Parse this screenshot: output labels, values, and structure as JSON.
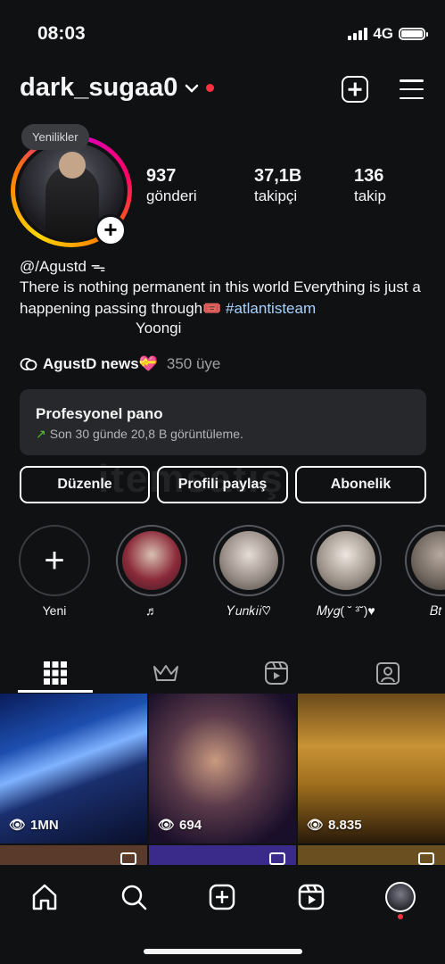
{
  "status_bar": {
    "time": "08:03",
    "network": "4G"
  },
  "header": {
    "username": "dark_sugaa0"
  },
  "profile": {
    "notes_bubble": "Yenilikler",
    "stats": [
      {
        "value": "937",
        "label": "gönderi"
      },
      {
        "value": "37,1B",
        "label": "takipçi"
      },
      {
        "value": "136",
        "label": "takip"
      }
    ],
    "handle": "@/Agustd ᯓ",
    "bio_text": "There is nothing permanent in this world Everything is just a happening passing through🎟️",
    "bio_hashtag": "#atlantisteam",
    "bio_name": "Yoongi",
    "channel": {
      "name": "AgustD news💝",
      "members": "350 üye"
    }
  },
  "dashboard": {
    "title": "Profesyonel pano",
    "subtitle": "Son 30 günde 20,8 B görüntüleme.",
    "trend_color": "#58c322"
  },
  "buttons": {
    "edit": "Düzenle",
    "share": "Profili paylaş",
    "subscription": "Abonelik"
  },
  "highlights": [
    {
      "label": "Yeni"
    },
    {
      "label": "♬"
    },
    {
      "label": "𝑌𝑢𝑛𝑘𝑖𝑖♡"
    },
    {
      "label": "𝑀𝑦𝑔( ˘ ³˘)♥"
    },
    {
      "label": "𝐵𝑡"
    }
  ],
  "tabs": [
    "grid-icon",
    "crown-icon",
    "reels-icon",
    "tagged-icon"
  ],
  "grid": [
    {
      "views": "1MN"
    },
    {
      "views": "694"
    },
    {
      "views": "8.835"
    }
  ],
  "watermark": "itemsatış",
  "colors": {
    "background": "#0f1113",
    "link": "#a9d3ff",
    "notification": "#ff3040",
    "panel": "#26282c"
  }
}
